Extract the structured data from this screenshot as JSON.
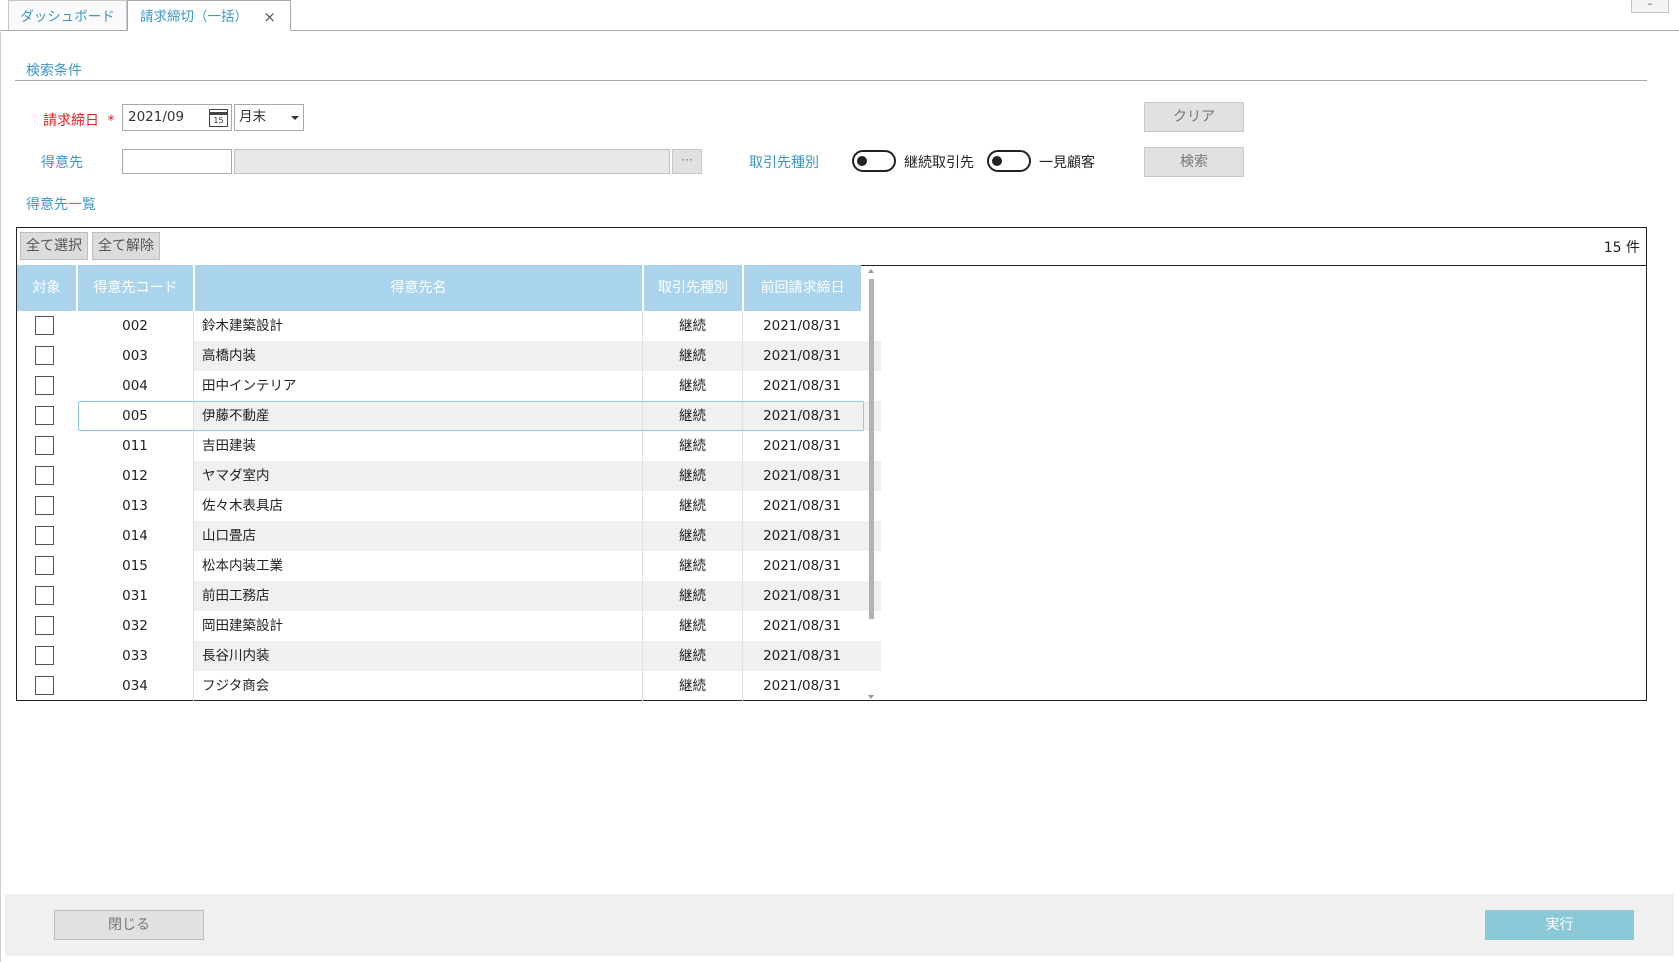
{
  "tabs": [
    {
      "label": "ダッシュボード"
    },
    {
      "label": "請求締切（一括）",
      "close": "×"
    }
  ],
  "window": {
    "minimize": "–"
  },
  "search": {
    "section_title": "検索条件",
    "closing_date_label": "請求締日",
    "required_mark": "*",
    "closing_date_value": "2021/09",
    "calendar_icon_text": "15",
    "closing_day_select": "月末",
    "customer_label": "得意先",
    "customer_code_value": "",
    "customer_name_value": "",
    "lookup_button": "···",
    "kind_label": "取引先種別",
    "toggle_continuing_label": "継続取引先",
    "toggle_onetime_label": "一見顧客",
    "clear_button": "クリア",
    "search_button": "検索"
  },
  "list": {
    "section_title": "得意先一覧",
    "select_all": "全て選択",
    "deselect_all": "全て解除",
    "count": "15 件",
    "columns": [
      "対象",
      "得意先コード",
      "得意先名",
      "取引先種別",
      "前回請求締日"
    ],
    "rows": [
      {
        "code": "002",
        "name": "鈴木建築設計",
        "kind": "継続",
        "date": "2021/08/31"
      },
      {
        "code": "003",
        "name": "高橋内装",
        "kind": "継続",
        "date": "2021/08/31"
      },
      {
        "code": "004",
        "name": "田中インテリア",
        "kind": "継続",
        "date": "2021/08/31"
      },
      {
        "code": "005",
        "name": "伊藤不動産",
        "kind": "継続",
        "date": "2021/08/31"
      },
      {
        "code": "011",
        "name": "吉田建装",
        "kind": "継続",
        "date": "2021/08/31"
      },
      {
        "code": "012",
        "name": "ヤマダ室内",
        "kind": "継続",
        "date": "2021/08/31"
      },
      {
        "code": "013",
        "name": "佐々木表具店",
        "kind": "継続",
        "date": "2021/08/31"
      },
      {
        "code": "014",
        "name": "山口畳店",
        "kind": "継続",
        "date": "2021/08/31"
      },
      {
        "code": "015",
        "name": "松本内装工業",
        "kind": "継続",
        "date": "2021/08/31"
      },
      {
        "code": "031",
        "name": "前田工務店",
        "kind": "継続",
        "date": "2021/08/31"
      },
      {
        "code": "032",
        "name": "岡田建築設計",
        "kind": "継続",
        "date": "2021/08/31"
      },
      {
        "code": "033",
        "name": "長谷川内装",
        "kind": "継続",
        "date": "2021/08/31"
      },
      {
        "code": "034",
        "name": "フジタ商会",
        "kind": "継続",
        "date": "2021/08/31"
      }
    ]
  },
  "footer": {
    "close_button": "閉じる",
    "execute_button": "実行"
  },
  "colors": {
    "accent": "#3c97c8",
    "header_bg": "#aad4ee",
    "execute_bg": "#89c9d8",
    "required": "#e02020"
  }
}
